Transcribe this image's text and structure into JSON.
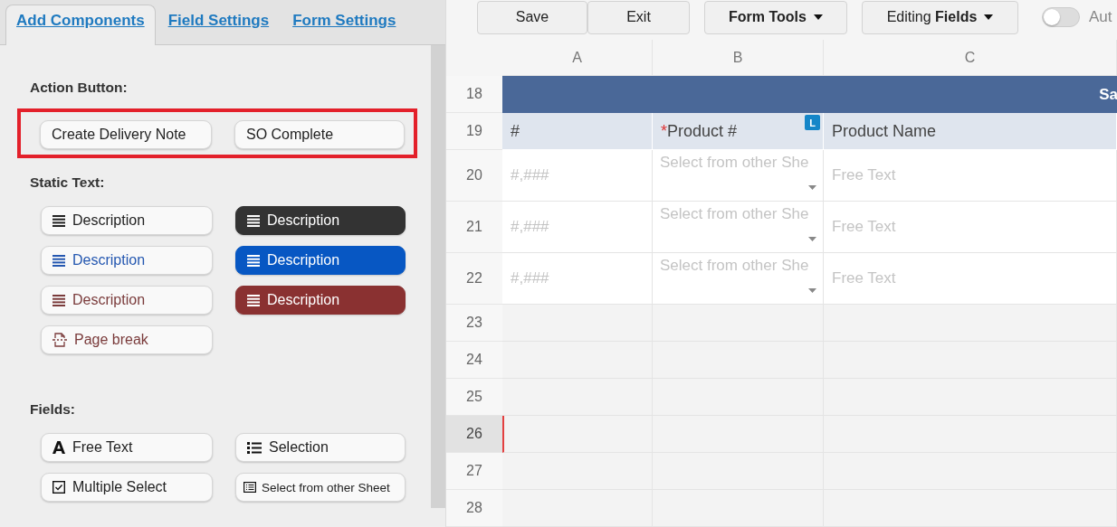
{
  "tabs": [
    {
      "label": "Add Components",
      "selected": true
    },
    {
      "label": "Field Settings",
      "selected": false
    },
    {
      "label": "Form Settings",
      "selected": false
    }
  ],
  "action_button": {
    "heading": "Action Button:",
    "highlighted": true,
    "buttons": [
      "Create Delivery Note",
      "SO Complete"
    ]
  },
  "static_text": {
    "heading": "Static Text:",
    "items": [
      {
        "kind": "description",
        "label": "Description",
        "color": "#222222",
        "filled": false
      },
      {
        "kind": "description",
        "label": "Description",
        "color": "#333333",
        "filled": true
      },
      {
        "kind": "description",
        "label": "Description",
        "color": "#2457b0",
        "filled": false
      },
      {
        "kind": "description",
        "label": "Description",
        "color": "#0757c3",
        "filled": true
      },
      {
        "kind": "description",
        "label": "Description",
        "color": "#7a3b3b",
        "filled": false
      },
      {
        "kind": "description",
        "label": "Description",
        "color": "#8a3131",
        "filled": true
      },
      {
        "kind": "page-break",
        "label": "Page break",
        "color": "#7a3b3b",
        "filled": false
      }
    ]
  },
  "fields": {
    "heading": "Fields:",
    "items": [
      {
        "kind": "free-text",
        "label": "Free Text"
      },
      {
        "kind": "selection",
        "label": "Selection"
      },
      {
        "kind": "multiple-select",
        "label": "Multiple Select"
      },
      {
        "kind": "sheet-select",
        "label": "Select from other Sheet"
      }
    ]
  },
  "toolbar": {
    "buttons": [
      {
        "kind": "plain",
        "label": "Save"
      },
      {
        "kind": "plain",
        "label": "Exit"
      },
      {
        "kind": "menu",
        "label": "Form Tools"
      },
      {
        "kind": "menu-light",
        "label": "Editing **Fields**"
      }
    ],
    "toggle": {
      "label": "Aut",
      "on": false
    }
  },
  "sheet": {
    "columns": [
      "A",
      "B",
      "C"
    ],
    "rows": [
      {
        "number": "18",
        "kind": "banner",
        "text": "Sa",
        "selected": false
      },
      {
        "number": "19",
        "kind": "header",
        "selected": false,
        "cells": [
          {
            "text": "#"
          },
          {
            "marker": "*",
            "text": "Product #",
            "badge": "L"
          },
          {
            "text": "Product Name"
          }
        ]
      },
      {
        "number": "20",
        "kind": "entry",
        "selected": false,
        "cells": [
          {
            "placeholder": "#,###"
          },
          {
            "placeholder": "Select from other She",
            "dropdown": true
          },
          {
            "placeholder": "Free Text"
          }
        ]
      },
      {
        "number": "21",
        "kind": "entry",
        "selected": false,
        "cells": [
          {
            "placeholder": "#,###"
          },
          {
            "placeholder": "Select from other She",
            "dropdown": true
          },
          {
            "placeholder": "Free Text"
          }
        ]
      },
      {
        "number": "22",
        "kind": "entry",
        "selected": false,
        "cells": [
          {
            "placeholder": "#,###"
          },
          {
            "placeholder": "Select from other She",
            "dropdown": true
          },
          {
            "placeholder": "Free Text"
          }
        ]
      },
      {
        "number": "23",
        "kind": "empty",
        "selected": false
      },
      {
        "number": "24",
        "kind": "empty",
        "selected": false
      },
      {
        "number": "25",
        "kind": "empty",
        "selected": false
      },
      {
        "number": "26",
        "kind": "empty",
        "selected": true
      },
      {
        "number": "27",
        "kind": "empty",
        "selected": false
      },
      {
        "number": "28",
        "kind": "empty",
        "selected": false
      }
    ]
  }
}
